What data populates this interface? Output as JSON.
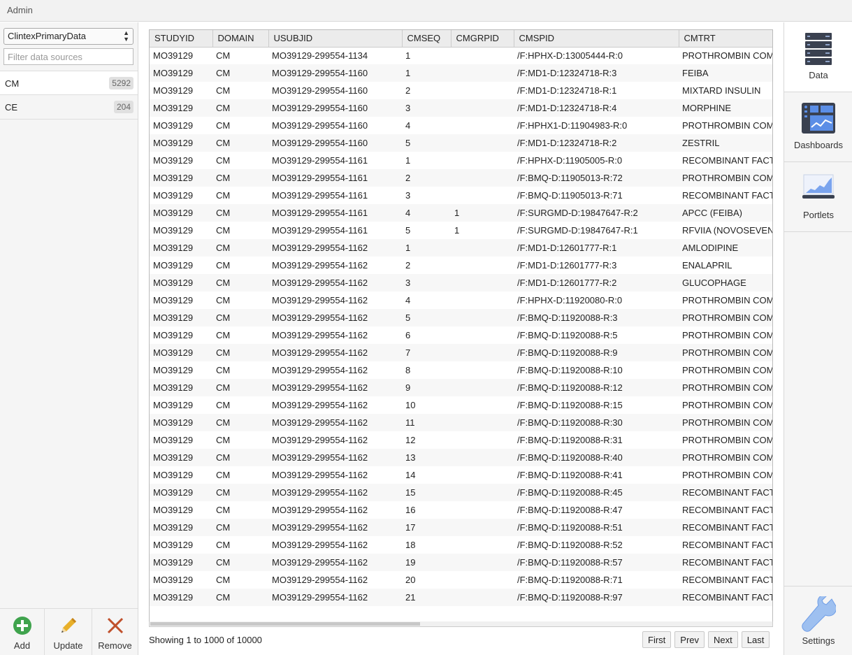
{
  "app": {
    "title": "Admin"
  },
  "sidebar": {
    "datasource_select": "ClintexPrimaryData",
    "filter_placeholder": "Filter data sources",
    "items": [
      {
        "label": "CM",
        "count": "5292"
      },
      {
        "label": "CE",
        "count": "204"
      }
    ],
    "tools": [
      {
        "label": "Add",
        "icon": "add-circle-icon"
      },
      {
        "label": "Update",
        "icon": "pencil-icon"
      },
      {
        "label": "Remove",
        "icon": "close-x-icon"
      }
    ]
  },
  "table": {
    "columns": [
      "STUDYID",
      "DOMAIN",
      "USUBJID",
      "CMSEQ",
      "CMGRPID",
      "CMSPID",
      "CMTRT"
    ],
    "rows": [
      [
        "MO39129",
        "CM",
        "MO39129-299554-1134",
        "1",
        "",
        "/F:HPHX-D:13005444-R:0",
        "PROTHROMBIN COM"
      ],
      [
        "MO39129",
        "CM",
        "MO39129-299554-1160",
        "1",
        "",
        "/F:MD1-D:12324718-R:3",
        "FEIBA"
      ],
      [
        "MO39129",
        "CM",
        "MO39129-299554-1160",
        "2",
        "",
        "/F:MD1-D:12324718-R:1",
        "MIXTARD INSULIN"
      ],
      [
        "MO39129",
        "CM",
        "MO39129-299554-1160",
        "3",
        "",
        "/F:MD1-D:12324718-R:4",
        "MORPHINE"
      ],
      [
        "MO39129",
        "CM",
        "MO39129-299554-1160",
        "4",
        "",
        "/F:HPHX1-D:11904983-R:0",
        "PROTHROMBIN COM"
      ],
      [
        "MO39129",
        "CM",
        "MO39129-299554-1160",
        "5",
        "",
        "/F:MD1-D:12324718-R:2",
        "ZESTRIL"
      ],
      [
        "MO39129",
        "CM",
        "MO39129-299554-1161",
        "1",
        "",
        "/F:HPHX-D:11905005-R:0",
        "RECOMBINANT FACT"
      ],
      [
        "MO39129",
        "CM",
        "MO39129-299554-1161",
        "2",
        "",
        "/F:BMQ-D:11905013-R:72",
        "PROTHROMBIN COM"
      ],
      [
        "MO39129",
        "CM",
        "MO39129-299554-1161",
        "3",
        "",
        "/F:BMQ-D:11905013-R:71",
        "RECOMBINANT FACT"
      ],
      [
        "MO39129",
        "CM",
        "MO39129-299554-1161",
        "4",
        "1",
        "/F:SURGMD-D:19847647-R:2",
        "APCC (FEIBA)"
      ],
      [
        "MO39129",
        "CM",
        "MO39129-299554-1161",
        "5",
        "1",
        "/F:SURGMD-D:19847647-R:1",
        "RFVIIA (NOVOSEVEN"
      ],
      [
        "MO39129",
        "CM",
        "MO39129-299554-1162",
        "1",
        "",
        "/F:MD1-D:12601777-R:1",
        "AMLODIPINE"
      ],
      [
        "MO39129",
        "CM",
        "MO39129-299554-1162",
        "2",
        "",
        "/F:MD1-D:12601777-R:3",
        "ENALAPRIL"
      ],
      [
        "MO39129",
        "CM",
        "MO39129-299554-1162",
        "3",
        "",
        "/F:MD1-D:12601777-R:2",
        "GLUCOPHAGE"
      ],
      [
        "MO39129",
        "CM",
        "MO39129-299554-1162",
        "4",
        "",
        "/F:HPHX-D:11920080-R:0",
        "PROTHROMBIN COM"
      ],
      [
        "MO39129",
        "CM",
        "MO39129-299554-1162",
        "5",
        "",
        "/F:BMQ-D:11920088-R:3",
        "PROTHROMBIN COM"
      ],
      [
        "MO39129",
        "CM",
        "MO39129-299554-1162",
        "6",
        "",
        "/F:BMQ-D:11920088-R:5",
        "PROTHROMBIN COM"
      ],
      [
        "MO39129",
        "CM",
        "MO39129-299554-1162",
        "7",
        "",
        "/F:BMQ-D:11920088-R:9",
        "PROTHROMBIN COM"
      ],
      [
        "MO39129",
        "CM",
        "MO39129-299554-1162",
        "8",
        "",
        "/F:BMQ-D:11920088-R:10",
        "PROTHROMBIN COM"
      ],
      [
        "MO39129",
        "CM",
        "MO39129-299554-1162",
        "9",
        "",
        "/F:BMQ-D:11920088-R:12",
        "PROTHROMBIN COM"
      ],
      [
        "MO39129",
        "CM",
        "MO39129-299554-1162",
        "10",
        "",
        "/F:BMQ-D:11920088-R:15",
        "PROTHROMBIN COM"
      ],
      [
        "MO39129",
        "CM",
        "MO39129-299554-1162",
        "11",
        "",
        "/F:BMQ-D:11920088-R:30",
        "PROTHROMBIN COM"
      ],
      [
        "MO39129",
        "CM",
        "MO39129-299554-1162",
        "12",
        "",
        "/F:BMQ-D:11920088-R:31",
        "PROTHROMBIN COM"
      ],
      [
        "MO39129",
        "CM",
        "MO39129-299554-1162",
        "13",
        "",
        "/F:BMQ-D:11920088-R:40",
        "PROTHROMBIN COM"
      ],
      [
        "MO39129",
        "CM",
        "MO39129-299554-1162",
        "14",
        "",
        "/F:BMQ-D:11920088-R:41",
        "PROTHROMBIN COM"
      ],
      [
        "MO39129",
        "CM",
        "MO39129-299554-1162",
        "15",
        "",
        "/F:BMQ-D:11920088-R:45",
        "RECOMBINANT FACT"
      ],
      [
        "MO39129",
        "CM",
        "MO39129-299554-1162",
        "16",
        "",
        "/F:BMQ-D:11920088-R:47",
        "RECOMBINANT FACT"
      ],
      [
        "MO39129",
        "CM",
        "MO39129-299554-1162",
        "17",
        "",
        "/F:BMQ-D:11920088-R:51",
        "RECOMBINANT FACT"
      ],
      [
        "MO39129",
        "CM",
        "MO39129-299554-1162",
        "18",
        "",
        "/F:BMQ-D:11920088-R:52",
        "RECOMBINANT FACT"
      ],
      [
        "MO39129",
        "CM",
        "MO39129-299554-1162",
        "19",
        "",
        "/F:BMQ-D:11920088-R:57",
        "RECOMBINANT FACT"
      ],
      [
        "MO39129",
        "CM",
        "MO39129-299554-1162",
        "20",
        "",
        "/F:BMQ-D:11920088-R:71",
        "RECOMBINANT FACT"
      ],
      [
        "MO39129",
        "CM",
        "MO39129-299554-1162",
        "21",
        "",
        "/F:BMQ-D:11920088-R:97",
        "RECOMBINANT FACT"
      ]
    ]
  },
  "footer": {
    "status": "Showing 1 to 1000 of 10000",
    "pager": [
      "First",
      "Prev",
      "Next",
      "Last"
    ]
  },
  "rightnav": {
    "items": [
      {
        "label": "Data",
        "icon": "server-stack-icon"
      },
      {
        "label": "Dashboards",
        "icon": "dashboard-icon"
      },
      {
        "label": "Portlets",
        "icon": "portlet-chart-icon"
      }
    ],
    "settings_label": "Settings",
    "settings_icon": "wrench-icon"
  },
  "colors": {
    "add": "#3fa34d",
    "update": "#e0a100",
    "remove": "#c0502b",
    "icon_dark": "#3a4150",
    "icon_blue": "#5b8ee6"
  }
}
